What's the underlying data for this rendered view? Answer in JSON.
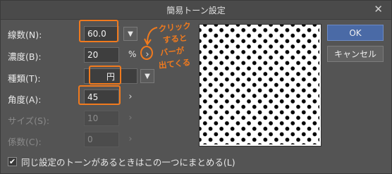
{
  "window": {
    "title": "簡易トーン設定",
    "close_glyph": "✕"
  },
  "form": {
    "lines": {
      "label": "線数(N):",
      "value": "60.0"
    },
    "density": {
      "label": "濃度(B):",
      "value": "20",
      "unit": "%"
    },
    "type": {
      "label": "種類(T):",
      "value": "円"
    },
    "angle": {
      "label": "角度(A):",
      "value": "45"
    },
    "size": {
      "label": "サイズ(S):",
      "value": "10"
    },
    "coefficient": {
      "label": "係数(C):",
      "value": "0"
    }
  },
  "buttons": {
    "ok": "OK",
    "cancel": "キャンセル"
  },
  "checkbox": {
    "label": "同じ設定のトーンがあるときはこの一つにまとめる(L)",
    "checked": true
  },
  "annotation": {
    "lines": [
      "クリック",
      "すると",
      "バーが",
      "出てくる"
    ],
    "color": "#f07a1e"
  },
  "icons": {
    "dropdown": "chevron-down-icon",
    "arrow": "chevron-right-icon",
    "check": "checkmark-icon"
  }
}
